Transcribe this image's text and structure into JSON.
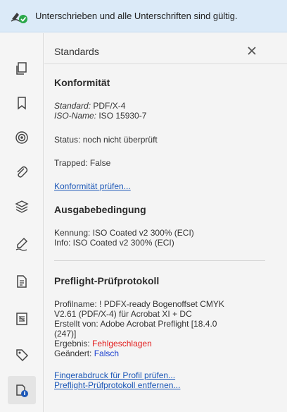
{
  "signature_bar": {
    "text": "Unterschrieben und alle Unterschriften sind gültig.",
    "icon": "signature-valid-icon",
    "accent": "#2aa84a"
  },
  "left_rail": {
    "items": [
      {
        "icon": "pages-icon"
      },
      {
        "icon": "bookmark-icon"
      },
      {
        "icon": "layers-target-icon"
      },
      {
        "icon": "attachment-icon"
      },
      {
        "icon": "layers-icon"
      },
      {
        "icon": "signature-pen-icon"
      },
      {
        "icon": "document-icon"
      },
      {
        "icon": "content-icon"
      },
      {
        "icon": "tag-icon"
      },
      {
        "icon": "standards-icon",
        "active": true
      }
    ]
  },
  "panel": {
    "title": "Standards",
    "close": "×",
    "konformitaet": {
      "title": "Konformität",
      "standard_label": "Standard:",
      "standard_value": " PDF/X-4",
      "iso_label": "ISO-Name:",
      "iso_value": " ISO 15930-7",
      "status": "Status: noch nicht überprüft",
      "trapped": "Trapped: False",
      "link": "Konformität prüfen..."
    },
    "ausgabe": {
      "title": "Ausgabebedingung",
      "kennung": "Kennung: ISO Coated v2 300% (ECI)",
      "info": "Info: ISO Coated v2 300% (ECI)"
    },
    "preflight": {
      "title": "Preflight-Prüfprotokoll",
      "profil_line1": "Profilname: ! PDFX-ready Bogenoffset CMYK",
      "profil_line2": "V2.61 (PDF/X-4) für Acrobat XI + DC",
      "erstellt_line1": "Erstellt von: Adobe Acrobat Preflight [18.4.0",
      "erstellt_line2": "(247)]",
      "ergebnis_label": "Ergebnis: ",
      "ergebnis_value": "Fehlgeschlagen",
      "geaendert_label": "Geändert: ",
      "geaendert_value": "Falsch",
      "link1": "Fingerabdruck für Profil prüfen...",
      "link2": "Preflight-Prüfprotokoll entfernen..."
    }
  },
  "colors": {
    "link": "#1b57b7",
    "fail": "#e21b1b",
    "false_value": "#1a3fcf",
    "sigbar_bg": "#dbeaf8"
  }
}
